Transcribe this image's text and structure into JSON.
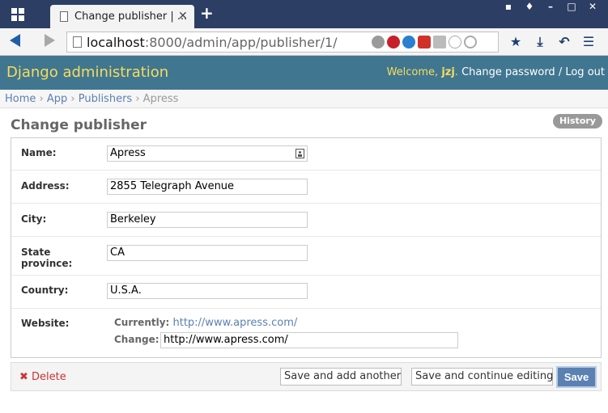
{
  "browser": {
    "tab_title": "Change publisher | ...",
    "tab_close": "✕",
    "new_tab": "+",
    "url_host": "localhost",
    "url_rest": ":8000/admin/app/publisher/1/"
  },
  "header": {
    "brand": "Django administration",
    "welcome": "Welcome, ",
    "username": "jzj",
    "change_password": "Change password",
    "separator": " / ",
    "logout": "Log out"
  },
  "breadcrumbs": {
    "home": "Home",
    "app": "App",
    "model": "Publishers",
    "current": "Apress",
    "sep": " › "
  },
  "page": {
    "title": "Change publisher",
    "history": "History"
  },
  "form": {
    "name": {
      "label": "Name:",
      "value": "Apress"
    },
    "address": {
      "label": "Address:",
      "value": "2855 Telegraph Avenue"
    },
    "city": {
      "label": "City:",
      "value": "Berkeley"
    },
    "state": {
      "label_line1": "State",
      "label_line2": "province:",
      "value": "CA"
    },
    "country": {
      "label": "Country:",
      "value": "U.S.A."
    },
    "website": {
      "label": "Website:",
      "currently_label": "Currently:",
      "currently_value": "http://www.apress.com/",
      "change_label": "Change:",
      "change_value": "http://www.apress.com/"
    }
  },
  "submit": {
    "delete_icon": "✖",
    "delete": "Delete",
    "save_add_another": "Save and add another",
    "save_continue": "Save and continue editing",
    "save": "Save"
  },
  "colors": {
    "header_bg": "#417690",
    "brand_yellow": "#f5dd5d",
    "link_blue": "#5b80b2",
    "delete_red": "#cc3434",
    "tabbar_bg": "#2c3e63"
  },
  "icons": {
    "apps": "apps-grid-icon",
    "page": "document-icon",
    "back": "back-arrow-icon",
    "forward": "forward-arrow-icon",
    "contact_card": "contact-card-icon"
  }
}
